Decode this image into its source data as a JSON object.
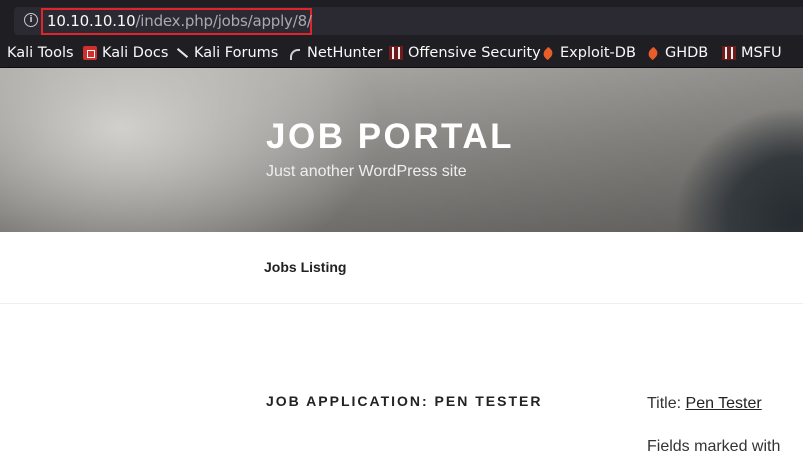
{
  "browser": {
    "url_host": "10.10.10.10",
    "url_path": "/index.php/jobs/apply/8/",
    "bookmarks": [
      {
        "label": "Kali Tools",
        "icon": "kali-tools-icon"
      },
      {
        "label": "Kali Docs",
        "icon": "kali-docs-icon"
      },
      {
        "label": "Kali Forums",
        "icon": "kali-forums-icon"
      },
      {
        "label": "NetHunter",
        "icon": "nethunter-icon"
      },
      {
        "label": "Offensive Security",
        "icon": "offensive-security-icon"
      },
      {
        "label": "Exploit-DB",
        "icon": "exploit-db-icon"
      },
      {
        "label": "GHDB",
        "icon": "ghdb-icon"
      },
      {
        "label": "MSFU",
        "icon": "msfu-icon"
      }
    ]
  },
  "site": {
    "title": "JOB PORTAL",
    "description": "Just another WordPress site"
  },
  "nav": {
    "jobs_listing": "Jobs Listing"
  },
  "main": {
    "entry_title": "JOB APPLICATION: PEN TESTER"
  },
  "sidebar": {
    "title_label": "Title:",
    "title_link": "Pen Tester",
    "cut_text": "Fields marked with"
  },
  "colors": {
    "url_highlight_border": "#e1242a",
    "chrome_bg": "#1f1f23"
  }
}
